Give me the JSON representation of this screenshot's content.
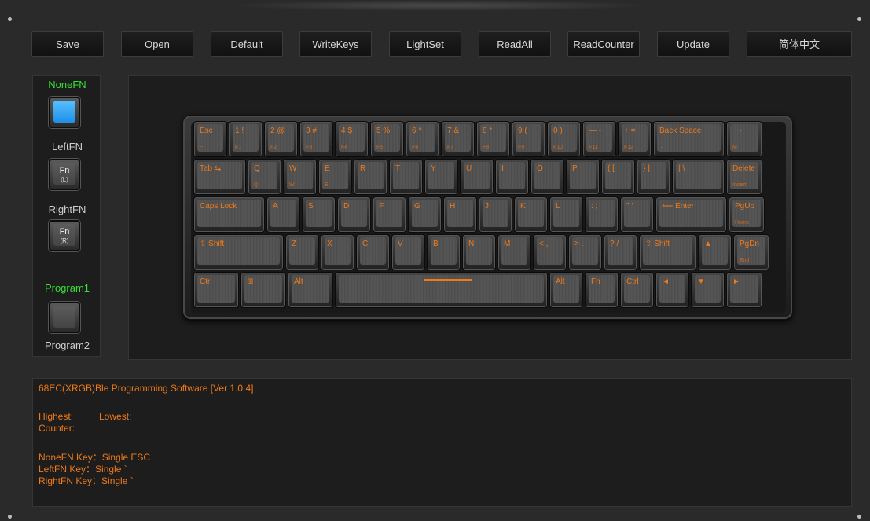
{
  "toolbar": [
    {
      "name": "save-button",
      "label": "Save"
    },
    {
      "name": "open-button",
      "label": "Open"
    },
    {
      "name": "default-button",
      "label": "Default"
    },
    {
      "name": "writekeys-button",
      "label": "WriteKeys"
    },
    {
      "name": "lightset-button",
      "label": "LightSet"
    },
    {
      "name": "readall-button",
      "label": "ReadAll"
    },
    {
      "name": "readcounter-button",
      "label": "ReadCounter"
    },
    {
      "name": "update-button",
      "label": "Update"
    },
    {
      "name": "language-button",
      "label": "简体中文"
    }
  ],
  "fn_panel": {
    "none_fn": "NoneFN",
    "left_fn": "LeftFN",
    "right_fn": "RightFN",
    "program1": "Program1",
    "program2": "Program2",
    "fn_l_main": "Fn",
    "fn_l_sub": "(L)",
    "fn_r_main": "Fn",
    "fn_r_sub": "(R)"
  },
  "keyboard": {
    "rows": [
      [
        {
          "l1": "Esc",
          "l2": "~ ·"
        },
        {
          "l1": "1  !",
          "l2": "F1"
        },
        {
          "l1": "2  @",
          "l2": "F2"
        },
        {
          "l1": "3  #",
          "l2": "F3"
        },
        {
          "l1": "4  $",
          "l2": "F4"
        },
        {
          "l1": "5  %",
          "l2": "F5"
        },
        {
          "l1": "6  ^",
          "l2": "F6"
        },
        {
          "l1": "7  &",
          "l2": "F7"
        },
        {
          "l1": "8  *",
          "l2": "F8"
        },
        {
          "l1": "9  (",
          "l2": "F9"
        },
        {
          "l1": "0  )",
          "l2": "F10"
        },
        {
          "l1": "—  -",
          "l2": "F11"
        },
        {
          "l1": "+  =",
          "l2": "F12"
        },
        {
          "l1": "Back Space",
          "l2": "←"
        },
        {
          "l1": "~ ·",
          "l2": "M"
        }
      ],
      [
        {
          "l1": "Tab ⇆",
          "l2": ""
        },
        {
          "l1": "Q",
          "l2": "Q"
        },
        {
          "l1": "W",
          "l2": "W"
        },
        {
          "l1": "E",
          "l2": "E"
        },
        {
          "l1": "R",
          "l2": ""
        },
        {
          "l1": "T",
          "l2": ""
        },
        {
          "l1": "Y",
          "l2": ""
        },
        {
          "l1": "U",
          "l2": ""
        },
        {
          "l1": "I",
          "l2": ""
        },
        {
          "l1": "O",
          "l2": ""
        },
        {
          "l1": "P",
          "l2": ""
        },
        {
          "l1": "{  [",
          "l2": ""
        },
        {
          "l1": "}  ]",
          "l2": ""
        },
        {
          "l1": "|  \\",
          "l2": ""
        },
        {
          "l1": "Delete",
          "l2": "Insert"
        }
      ],
      [
        {
          "l1": "Caps Lock",
          "l2": ""
        },
        {
          "l1": "A",
          "l2": ""
        },
        {
          "l1": "S",
          "l2": ""
        },
        {
          "l1": "D",
          "l2": ""
        },
        {
          "l1": "F",
          "l2": ""
        },
        {
          "l1": "G",
          "l2": ""
        },
        {
          "l1": "H",
          "l2": ""
        },
        {
          "l1": "J",
          "l2": ""
        },
        {
          "l1": "K",
          "l2": ""
        },
        {
          "l1": "L",
          "l2": ""
        },
        {
          "l1": ":  ;",
          "l2": ""
        },
        {
          "l1": "\"  '",
          "l2": ""
        },
        {
          "l1": "⟵ Enter",
          "l2": ""
        },
        {
          "l1": "PgUp",
          "l2": "Home"
        }
      ],
      [
        {
          "l1": "⇧ Shift",
          "l2": ""
        },
        {
          "l1": "Z",
          "l2": ""
        },
        {
          "l1": "X",
          "l2": ""
        },
        {
          "l1": "C",
          "l2": ""
        },
        {
          "l1": "V",
          "l2": ""
        },
        {
          "l1": "B",
          "l2": ""
        },
        {
          "l1": "N",
          "l2": ""
        },
        {
          "l1": "M",
          "l2": ""
        },
        {
          "l1": "<  ,",
          "l2": ""
        },
        {
          "l1": ">  .",
          "l2": ""
        },
        {
          "l1": "?  /",
          "l2": ""
        },
        {
          "l1": "⇧ Shift",
          "l2": ""
        },
        {
          "l1": "▲",
          "l2": ""
        },
        {
          "l1": "PgDn",
          "l2": "End"
        }
      ],
      [
        {
          "l1": "Ctrl",
          "l2": ""
        },
        {
          "l1": "⊞",
          "l2": ""
        },
        {
          "l1": "Alt",
          "l2": ""
        },
        {
          "l1": "",
          "l2": ""
        },
        {
          "l1": "Alt",
          "l2": ""
        },
        {
          "l1": "Fn",
          "l2": ""
        },
        {
          "l1": "Ctrl",
          "l2": ""
        },
        {
          "l1": "◄",
          "l2": ""
        },
        {
          "l1": "▼",
          "l2": ""
        },
        {
          "l1": "►",
          "l2": ""
        }
      ]
    ]
  },
  "info": {
    "title": "68EC(XRGB)Ble Programming Software [Ver 1.0.4]",
    "highest": "Highest:",
    "lowest": "Lowest:",
    "counter": "Counter:",
    "nonefn_key": "NoneFN Key：Single ESC",
    "leftfn_key": "LeftFN Key：Single `",
    "rightfn_key": "RightFN Key：Single `"
  }
}
